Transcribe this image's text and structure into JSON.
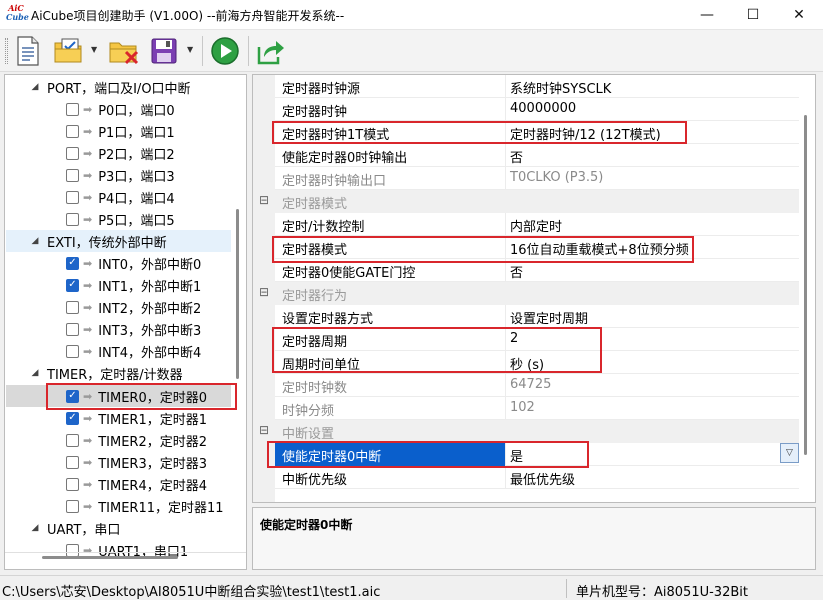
{
  "window": {
    "logo_top": "AiC",
    "logo_bottom": "Cube",
    "title": "AiCube项目创建助手 (V1.00O) --前海方舟智能开发系统--",
    "minimize_glyph": "—",
    "maximize_glyph": "☐",
    "close_glyph": "✕"
  },
  "toolbar": {
    "icons": [
      "new-document-icon",
      "open-project-icon",
      "delete-project-icon",
      "save-icon",
      "run-icon",
      "export-icon"
    ]
  },
  "tree": {
    "groups": [
      {
        "label": "PORT，端口及I/O口中断",
        "expanded": true,
        "items": [
          {
            "label": "P0口，端口0",
            "checked": false
          },
          {
            "label": "P1口，端口1",
            "checked": false
          },
          {
            "label": "P2口，端口2",
            "checked": false
          },
          {
            "label": "P3口，端口3",
            "checked": false
          },
          {
            "label": "P4口，端口4",
            "checked": false
          },
          {
            "label": "P5口，端口5",
            "checked": false
          }
        ]
      },
      {
        "label": "EXTI，传统外部中断",
        "expanded": true,
        "items": [
          {
            "label": "INT0，外部中断0",
            "checked": true
          },
          {
            "label": "INT1，外部中断1",
            "checked": true
          },
          {
            "label": "INT2，外部中断2",
            "checked": false
          },
          {
            "label": "INT3，外部中断3",
            "checked": false
          },
          {
            "label": "INT4，外部中断4",
            "checked": false
          }
        ]
      },
      {
        "label": "TIMER，定时器/计数器",
        "expanded": true,
        "items": [
          {
            "label": "TIMER0，定时器0",
            "checked": true,
            "selected": true
          },
          {
            "label": "TIMER1，定时器1",
            "checked": true
          },
          {
            "label": "TIMER2，定时器2",
            "checked": false
          },
          {
            "label": "TIMER3，定时器3",
            "checked": false
          },
          {
            "label": "TIMER4，定时器4",
            "checked": false
          },
          {
            "label": "TIMER11，定时器11",
            "checked": false
          }
        ]
      },
      {
        "label": "UART，串口",
        "expanded": true,
        "items": [
          {
            "label": "UART1，串口1",
            "checked": false
          }
        ]
      }
    ],
    "check_glyph": "✓",
    "expand_glyph": "◢",
    "arrow_glyph": "➡"
  },
  "properties": {
    "rows": [
      {
        "name": "定时器时钟源",
        "value": "系统时钟SYSCLK"
      },
      {
        "name": "定时器时钟",
        "value": "40000000"
      },
      {
        "name": "定时器时钟1T模式",
        "value": "定时器时钟/12 (12T模式)"
      },
      {
        "name": "使能定时器0时钟输出",
        "value": "否"
      },
      {
        "name": "定时器时钟输出口",
        "value": "T0CLKO (P3.5)",
        "dim": true
      },
      {
        "category": "定时器模式"
      },
      {
        "name": "定时/计数控制",
        "value": "内部定时"
      },
      {
        "name": "定时器模式",
        "value": "16位自动重载模式+8位预分频"
      },
      {
        "name": "定时器0使能GATE门控",
        "value": "否"
      },
      {
        "category": "定时器行为"
      },
      {
        "name": "设置定时器方式",
        "value": "设置定时周期"
      },
      {
        "name": "定时器周期",
        "value": "2"
      },
      {
        "name": "周期时间单位",
        "value": "秒 (s)"
      },
      {
        "name": "定时时钟数",
        "value": "64725",
        "dim": true
      },
      {
        "name": "时钟分频",
        "value": "102",
        "dim": true
      },
      {
        "category": "中断设置"
      },
      {
        "name": "使能定时器0中断",
        "value": "是",
        "selected": true
      },
      {
        "name": "中断优先级",
        "value": "最低优先级"
      }
    ],
    "collapse_glyph": "⊟",
    "dropdown_glyph": "▽"
  },
  "description": {
    "title": "使能定时器0中断"
  },
  "status": {
    "path": "C:\\Users\\芯安\\Desktop\\AI8051U中断组合实验\\test1\\test1.aic",
    "mcu": "单片机型号：Ai8051U-32Bit"
  },
  "colors": {
    "highlight": "#d9262c",
    "selection": "#0a5fcc",
    "checkbox": "#1e65c9"
  }
}
